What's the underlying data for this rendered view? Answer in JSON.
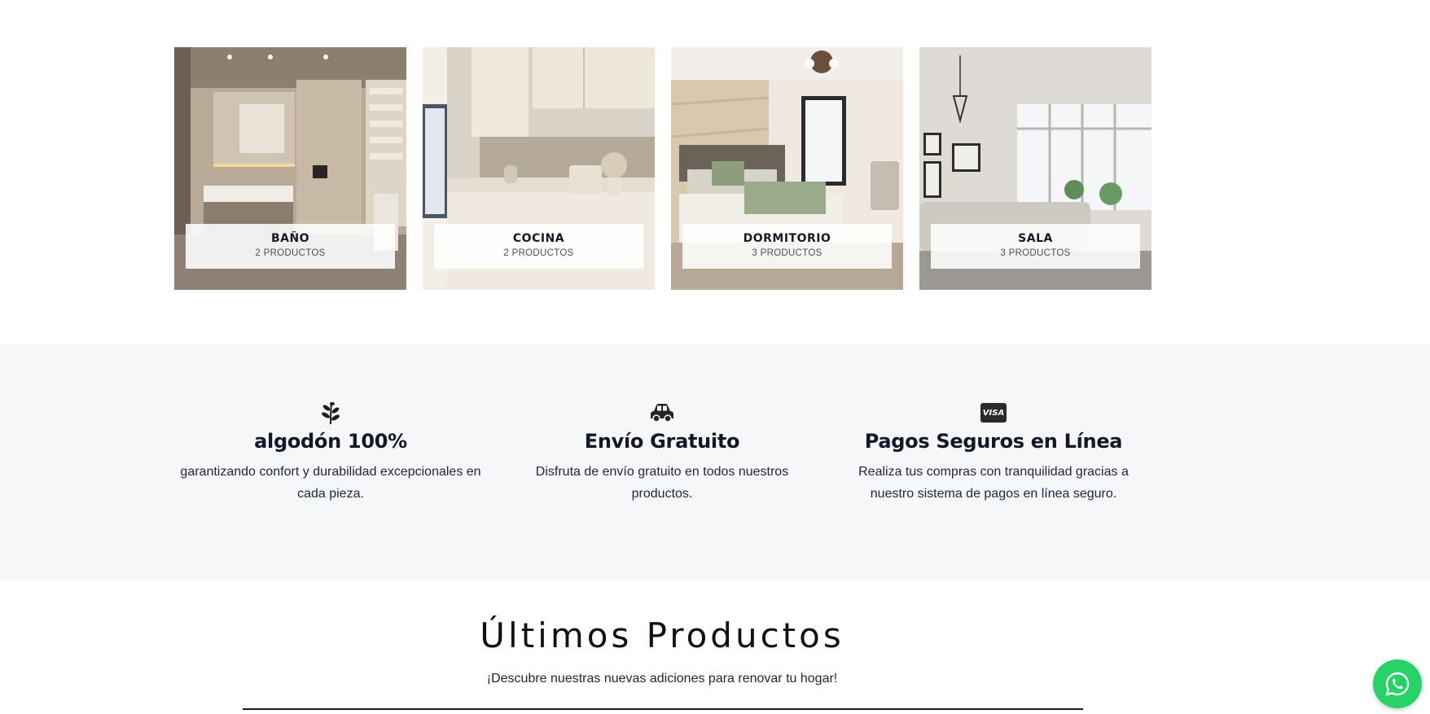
{
  "categories": [
    {
      "name": "BAÑO",
      "count": "2 PRODUCTOS"
    },
    {
      "name": "COCINA",
      "count": "2 PRODUCTOS"
    },
    {
      "name": "DORMITORIO",
      "count": "3 PRODUCTOS"
    },
    {
      "name": "SALA",
      "count": "3 PRODUCTOS"
    }
  ],
  "features": [
    {
      "icon": "leaf-icon",
      "title": "algodón 100%",
      "text": "garantizando confort y durabilidad excepcionales en cada pieza."
    },
    {
      "icon": "car-icon",
      "title": "Envío Gratuito",
      "text": "Disfruta de envío gratuito en todos nuestros productos."
    },
    {
      "icon": "visa-card-icon",
      "icon_text": "VISA",
      "title": "Pagos Seguros en Línea",
      "text": "Realiza tus compras con tranquilidad gracias a nuestro sistema de pagos en línea seguro."
    }
  ],
  "latest": {
    "title": "Últimos Productos",
    "subtitle": "¡Descubre nuestras nuevas adiciones para renovar tu hogar!"
  },
  "whatsapp": {
    "icon": "whatsapp-icon"
  },
  "colors": {
    "features_bg": "#f6f7f9",
    "whatsapp": "#25d366",
    "heading": "#131829"
  }
}
